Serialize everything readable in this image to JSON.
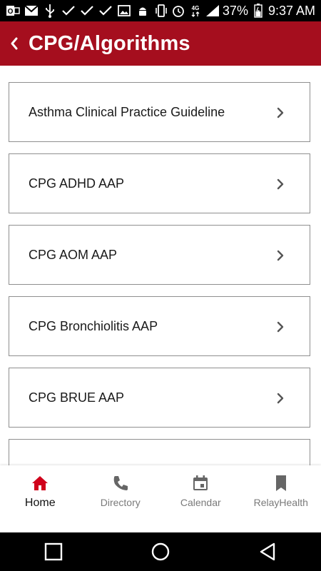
{
  "status_bar": {
    "left_icons": [
      "outlook-icon",
      "gmail-icon",
      "usb-icon",
      "check-icon",
      "check-icon",
      "check-icon",
      "image-icon",
      "android-debug-icon"
    ],
    "battery_percent": "37%",
    "time": "9:37 AM"
  },
  "header": {
    "title": "CPG/Algorithms",
    "back_icon": "chevron-left-icon"
  },
  "list": {
    "items": [
      {
        "label": "Asthma Clinical Practice Guideline"
      },
      {
        "label": "CPG ADHD AAP"
      },
      {
        "label": "CPG AOM AAP"
      },
      {
        "label": "CPG Bronchiolitis AAP"
      },
      {
        "label": "CPG BRUE AAP"
      },
      {
        "label": ""
      }
    ]
  },
  "bottom_nav": {
    "tabs": [
      {
        "label": "Home",
        "icon": "home-icon",
        "active": true
      },
      {
        "label": "Directory",
        "icon": "phone-icon",
        "active": false
      },
      {
        "label": "Calendar",
        "icon": "calendar-icon",
        "active": false
      },
      {
        "label": "RelayHealth",
        "icon": "bookmark-icon",
        "active": false
      }
    ]
  },
  "colors": {
    "brand": "#a50e1e",
    "active_tab": "#d0021b",
    "inactive_tab": "#777777"
  }
}
